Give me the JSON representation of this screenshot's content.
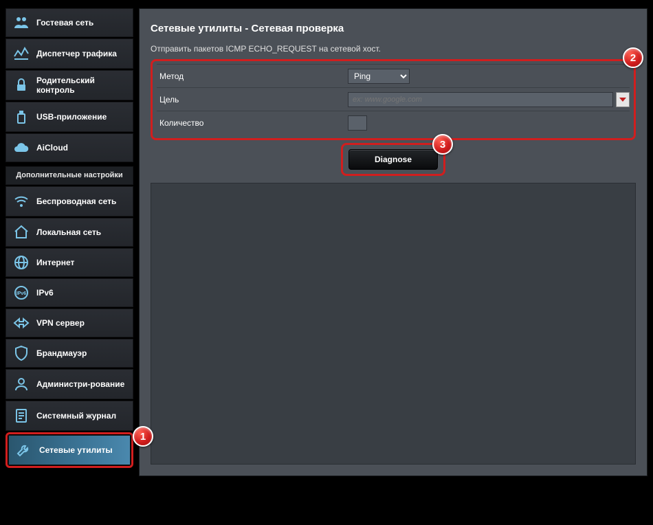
{
  "sidebar": {
    "main_items": [
      {
        "label": "Гостевая сеть",
        "icon": "users-icon"
      },
      {
        "label": "Диспетчер трафика",
        "icon": "traffic-icon"
      },
      {
        "label": "Родительский контроль",
        "icon": "lock-icon"
      },
      {
        "label": "USB-приложение",
        "icon": "usb-icon"
      },
      {
        "label": "AiCloud",
        "icon": "cloud-icon"
      }
    ],
    "advanced_header": "Дополнительные настройки",
    "advanced_items": [
      {
        "label": "Беспроводная сеть",
        "icon": "wifi-icon"
      },
      {
        "label": "Локальная сеть",
        "icon": "home-icon"
      },
      {
        "label": "Интернет",
        "icon": "globe-icon"
      },
      {
        "label": "IPv6",
        "icon": "ipv6-icon"
      },
      {
        "label": "VPN сервер",
        "icon": "vpn-icon"
      },
      {
        "label": "Брандмауэр",
        "icon": "shield-icon"
      },
      {
        "label": "Администри-рование",
        "icon": "admin-icon"
      },
      {
        "label": "Системный журнал",
        "icon": "log-icon"
      },
      {
        "label": "Сетевые утилиты",
        "icon": "wrench-icon",
        "active": true
      }
    ]
  },
  "main": {
    "title": "Сетевые утилиты - Сетевая проверка",
    "description": "Отправить пакетов ICMP ECHO_REQUEST на сетевой хост.",
    "method_label": "Метод",
    "method_value": "Ping",
    "target_label": "Цель",
    "target_placeholder": "ex: www.google.com",
    "count_label": "Количество",
    "diagnose_label": "Diagnose"
  },
  "badges": {
    "b1": "1",
    "b2": "2",
    "b3": "3"
  }
}
